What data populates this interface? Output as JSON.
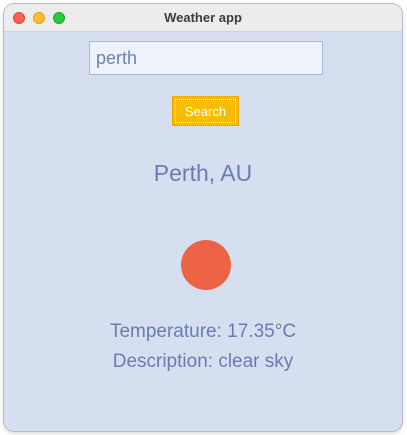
{
  "window": {
    "title": "Weather app"
  },
  "search": {
    "value": "perth",
    "button_label": "Search"
  },
  "result": {
    "city": "Perth, AU",
    "icon": "sun-icon",
    "icon_color": "#ec6445",
    "temperature": "Temperature: 17.35°C",
    "description": "Description: clear sky"
  },
  "colors": {
    "background": "#d5dff0",
    "accent": "#f9bc05",
    "text": "#6c7bb0"
  }
}
